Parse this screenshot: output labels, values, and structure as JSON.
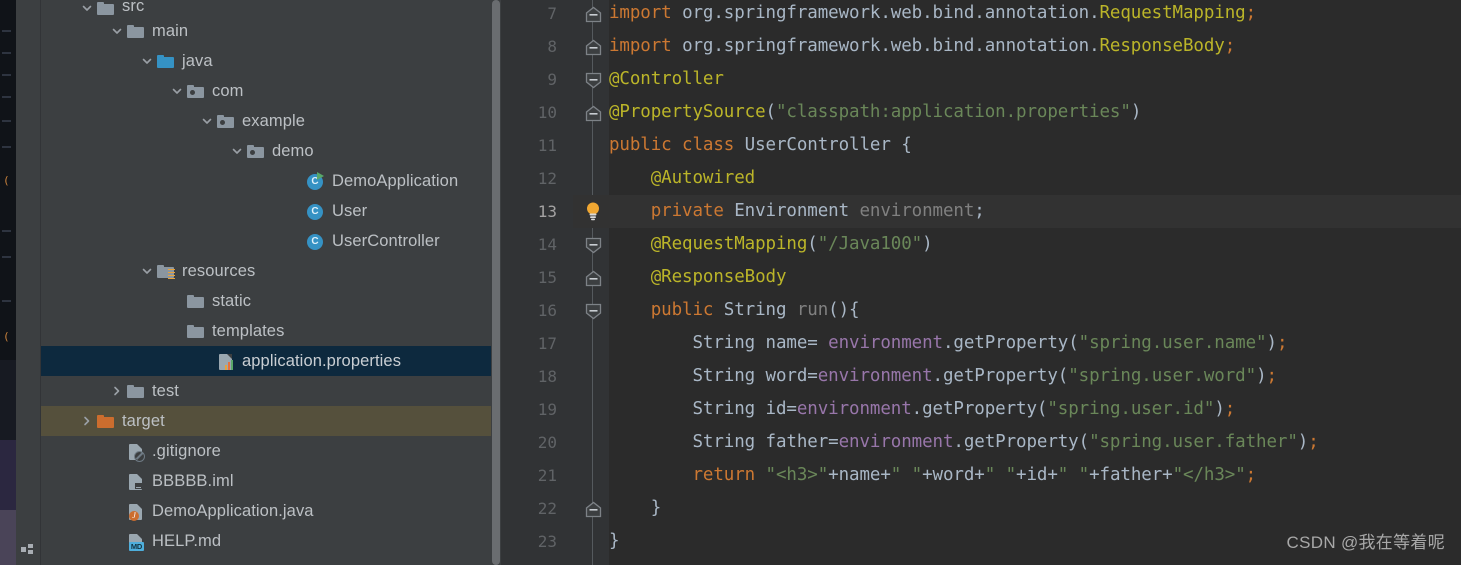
{
  "window": {
    "app": "IntelliJ IDEA",
    "theme_bg": "#3c3f41",
    "editor_bg": "#2b2b2b",
    "selection_bg": "#0d293e",
    "target_row_bg": "#55503c"
  },
  "tool_stripe": {
    "structure_label": "Structure",
    "structure_icon": "structure-icon"
  },
  "project_tree": {
    "rows": [
      {
        "label": "src",
        "indent": 3,
        "icon": "folder-grey-icon",
        "twisty": "chevron-down",
        "state": "partial"
      },
      {
        "label": "main",
        "indent": 4,
        "icon": "folder-grey-icon",
        "twisty": "chevron-down",
        "state": "normal"
      },
      {
        "label": "java",
        "indent": 5,
        "icon": "folder-source-blue-icon",
        "twisty": "chevron-down",
        "state": "normal"
      },
      {
        "label": "com",
        "indent": 6,
        "icon": "package-icon",
        "twisty": "chevron-down",
        "state": "normal"
      },
      {
        "label": "example",
        "indent": 7,
        "icon": "package-icon",
        "twisty": "chevron-down",
        "state": "normal"
      },
      {
        "label": "demo",
        "indent": 8,
        "icon": "package-icon",
        "twisty": "chevron-down",
        "state": "normal"
      },
      {
        "label": "DemoApplication",
        "indent": 10,
        "icon": "java-class-runnable-icon",
        "twisty": "none",
        "state": "normal"
      },
      {
        "label": "User",
        "indent": 10,
        "icon": "java-class-icon",
        "twisty": "none",
        "state": "normal"
      },
      {
        "label": "UserController",
        "indent": 10,
        "icon": "java-class-icon",
        "twisty": "none",
        "state": "normal"
      },
      {
        "label": "resources",
        "indent": 5,
        "icon": "folder-resources-icon",
        "twisty": "chevron-down",
        "state": "normal"
      },
      {
        "label": "static",
        "indent": 6,
        "icon": "folder-grey-icon",
        "twisty": "none",
        "state": "normal"
      },
      {
        "label": "templates",
        "indent": 6,
        "icon": "folder-grey-icon",
        "twisty": "none",
        "state": "normal"
      },
      {
        "label": "application.properties",
        "indent": 7,
        "icon": "properties-file-icon",
        "twisty": "none",
        "state": "selected"
      },
      {
        "label": "test",
        "indent": 4,
        "icon": "folder-grey-icon",
        "twisty": "chevron-right",
        "state": "normal"
      },
      {
        "label": "target",
        "indent": 3,
        "icon": "folder-orange-icon",
        "twisty": "chevron-right",
        "state": "highlighted"
      },
      {
        "label": ".gitignore",
        "indent": 4,
        "icon": "gitignore-file-icon",
        "twisty": "none",
        "state": "normal"
      },
      {
        "label": "BBBBB.iml",
        "indent": 4,
        "icon": "iml-file-icon",
        "twisty": "none",
        "state": "normal"
      },
      {
        "label": "DemoApplication.java",
        "indent": 4,
        "icon": "java-file-icon",
        "twisty": "none",
        "state": "normal"
      },
      {
        "label": "HELP.md",
        "indent": 4,
        "icon": "markdown-file-icon",
        "twisty": "none",
        "state": "normal"
      }
    ]
  },
  "editor": {
    "gutter_icons": {
      "intention_bulb": "lightbulb-icon",
      "fold_collapse": "fold-minus-icon"
    },
    "lines": [
      {
        "num": "7",
        "fold": "square",
        "current": false,
        "tokens": [
          {
            "t": "import ",
            "c": "k"
          },
          {
            "t": "org.springframework.web.bind.annotation.",
            "c": "cl"
          },
          {
            "t": "RequestMapping",
            "c": "an"
          },
          {
            "t": ";",
            "c": "k"
          }
        ]
      },
      {
        "num": "8",
        "fold": "square",
        "current": false,
        "tokens": [
          {
            "t": "import ",
            "c": "k"
          },
          {
            "t": "org.springframework.web.bind.annotation.",
            "c": "cl"
          },
          {
            "t": "ResponseBody",
            "c": "an"
          },
          {
            "t": ";",
            "c": "k"
          }
        ]
      },
      {
        "num": "9",
        "fold": "house",
        "current": false,
        "tokens": [
          {
            "t": "@Controller",
            "c": "an"
          }
        ]
      },
      {
        "num": "10",
        "fold": "square",
        "current": false,
        "tokens": [
          {
            "t": "@PropertySource",
            "c": "an"
          },
          {
            "t": "(",
            "c": "punc"
          },
          {
            "t": "\"classpath:application.properties\"",
            "c": "s"
          },
          {
            "t": ")",
            "c": "punc"
          }
        ]
      },
      {
        "num": "11",
        "fold": "none",
        "current": false,
        "tokens": [
          {
            "t": "public class ",
            "c": "k"
          },
          {
            "t": "UserController ",
            "c": "cl"
          },
          {
            "t": "{",
            "c": "punc"
          }
        ]
      },
      {
        "num": "12",
        "fold": "none",
        "current": false,
        "tokens": [
          {
            "t": "    @Autowired",
            "c": "an"
          }
        ]
      },
      {
        "num": "13",
        "fold": "bulb",
        "current": true,
        "tokens": [
          {
            "t": "    private ",
            "c": "k"
          },
          {
            "t": "Environment ",
            "c": "cl"
          },
          {
            "t": "environment",
            "c": "dim"
          },
          {
            "t": ";",
            "c": "punc"
          }
        ]
      },
      {
        "num": "14",
        "fold": "house",
        "current": false,
        "tokens": [
          {
            "t": "    @RequestMapping",
            "c": "an"
          },
          {
            "t": "(",
            "c": "punc"
          },
          {
            "t": "\"/Java100\"",
            "c": "s"
          },
          {
            "t": ")",
            "c": "punc"
          }
        ]
      },
      {
        "num": "15",
        "fold": "square",
        "current": false,
        "tokens": [
          {
            "t": "    @ResponseBody",
            "c": "an"
          }
        ]
      },
      {
        "num": "16",
        "fold": "house",
        "current": false,
        "tokens": [
          {
            "t": "    public ",
            "c": "k"
          },
          {
            "t": "String ",
            "c": "cl"
          },
          {
            "t": "run",
            "c": "dim"
          },
          {
            "t": "(){",
            "c": "punc"
          }
        ]
      },
      {
        "num": "17",
        "fold": "none",
        "current": false,
        "tokens": [
          {
            "t": "        String name",
            "c": "cl"
          },
          {
            "t": "= ",
            "c": "punc"
          },
          {
            "t": "environment",
            "c": "fld"
          },
          {
            "t": ".",
            "c": "punc"
          },
          {
            "t": "getProperty",
            "c": "cl"
          },
          {
            "t": "(",
            "c": "punc"
          },
          {
            "t": "\"spring.user.name\"",
            "c": "s"
          },
          {
            "t": ")",
            "c": "punc"
          },
          {
            "t": ";",
            "c": "k"
          }
        ]
      },
      {
        "num": "18",
        "fold": "none",
        "current": false,
        "tokens": [
          {
            "t": "        String word",
            "c": "cl"
          },
          {
            "t": "=",
            "c": "punc"
          },
          {
            "t": "environment",
            "c": "fld"
          },
          {
            "t": ".",
            "c": "punc"
          },
          {
            "t": "getProperty",
            "c": "cl"
          },
          {
            "t": "(",
            "c": "punc"
          },
          {
            "t": "\"spring.user.word\"",
            "c": "s"
          },
          {
            "t": ")",
            "c": "punc"
          },
          {
            "t": ";",
            "c": "k"
          }
        ]
      },
      {
        "num": "19",
        "fold": "none",
        "current": false,
        "tokens": [
          {
            "t": "        String id",
            "c": "cl"
          },
          {
            "t": "=",
            "c": "punc"
          },
          {
            "t": "environment",
            "c": "fld"
          },
          {
            "t": ".",
            "c": "punc"
          },
          {
            "t": "getProperty",
            "c": "cl"
          },
          {
            "t": "(",
            "c": "punc"
          },
          {
            "t": "\"spring.user.id\"",
            "c": "s"
          },
          {
            "t": ")",
            "c": "punc"
          },
          {
            "t": ";",
            "c": "k"
          }
        ]
      },
      {
        "num": "20",
        "fold": "none",
        "current": false,
        "tokens": [
          {
            "t": "        String father",
            "c": "cl"
          },
          {
            "t": "=",
            "c": "punc"
          },
          {
            "t": "environment",
            "c": "fld"
          },
          {
            "t": ".",
            "c": "punc"
          },
          {
            "t": "getProperty",
            "c": "cl"
          },
          {
            "t": "(",
            "c": "punc"
          },
          {
            "t": "\"spring.user.father\"",
            "c": "s"
          },
          {
            "t": ")",
            "c": "punc"
          },
          {
            "t": ";",
            "c": "k"
          }
        ]
      },
      {
        "num": "21",
        "fold": "none",
        "current": false,
        "tokens": [
          {
            "t": "        return ",
            "c": "k"
          },
          {
            "t": "\"<h3>\"",
            "c": "s"
          },
          {
            "t": "+name+",
            "c": "cl"
          },
          {
            "t": "\" \"",
            "c": "s"
          },
          {
            "t": "+word+",
            "c": "cl"
          },
          {
            "t": "\" \"",
            "c": "s"
          },
          {
            "t": "+id+",
            "c": "cl"
          },
          {
            "t": "\" \"",
            "c": "s"
          },
          {
            "t": "+father+",
            "c": "cl"
          },
          {
            "t": "\"</h3>\"",
            "c": "s"
          },
          {
            "t": ";",
            "c": "k"
          }
        ]
      },
      {
        "num": "22",
        "fold": "square",
        "current": false,
        "tokens": [
          {
            "t": "    }",
            "c": "punc"
          }
        ]
      },
      {
        "num": "23",
        "fold": "none",
        "current": false,
        "tokens": [
          {
            "t": "}",
            "c": "punc"
          }
        ]
      }
    ]
  },
  "watermark": {
    "text": "CSDN @我在等着呢"
  }
}
